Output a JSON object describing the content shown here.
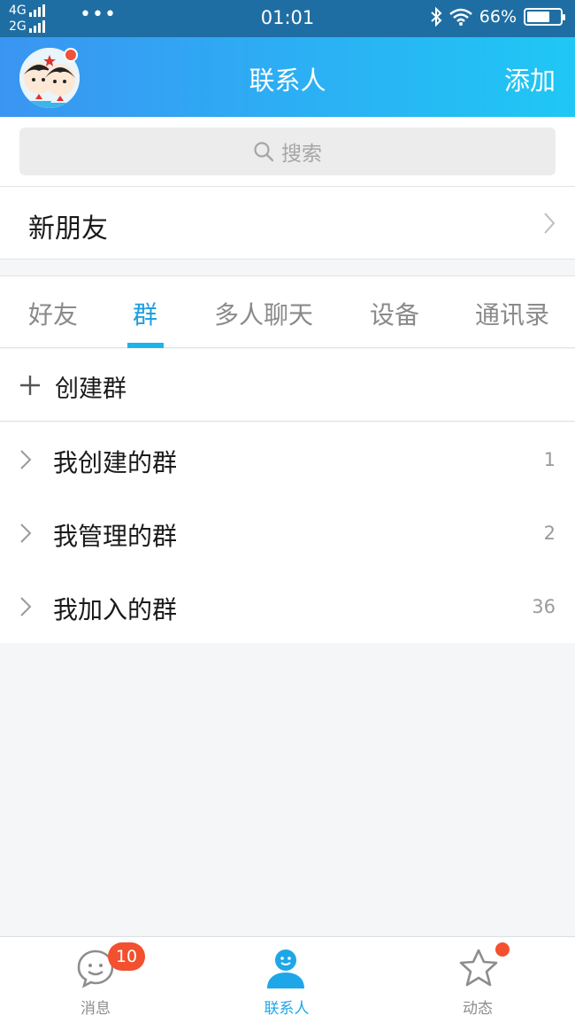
{
  "status_bar": {
    "network_top": "4G",
    "network_bottom": "2G",
    "dots": "•••",
    "time": "01:01",
    "battery": "66%"
  },
  "header": {
    "title": "联系人",
    "add_label": "添加"
  },
  "search": {
    "placeholder": "搜索"
  },
  "new_friends": {
    "label": "新朋友"
  },
  "tabs": [
    {
      "label": "好友",
      "active": false
    },
    {
      "label": "群",
      "active": true
    },
    {
      "label": "多人聊天",
      "active": false
    },
    {
      "label": "设备",
      "active": false
    },
    {
      "label": "通讯录",
      "active": false
    }
  ],
  "create_group": {
    "label": "创建群"
  },
  "groups": [
    {
      "label": "我创建的群",
      "count": "1"
    },
    {
      "label": "我管理的群",
      "count": "2"
    },
    {
      "label": "我加入的群",
      "count": "36"
    }
  ],
  "bottom_nav": {
    "messages": {
      "label": "消息",
      "badge": "10"
    },
    "contacts": {
      "label": "联系人"
    },
    "moments": {
      "label": "动态"
    }
  },
  "colors": {
    "accent": "#1ea7e8",
    "header_gradient_start": "#3a95f2",
    "header_gradient_end": "#1fc7f5",
    "badge": "#f2502f"
  }
}
